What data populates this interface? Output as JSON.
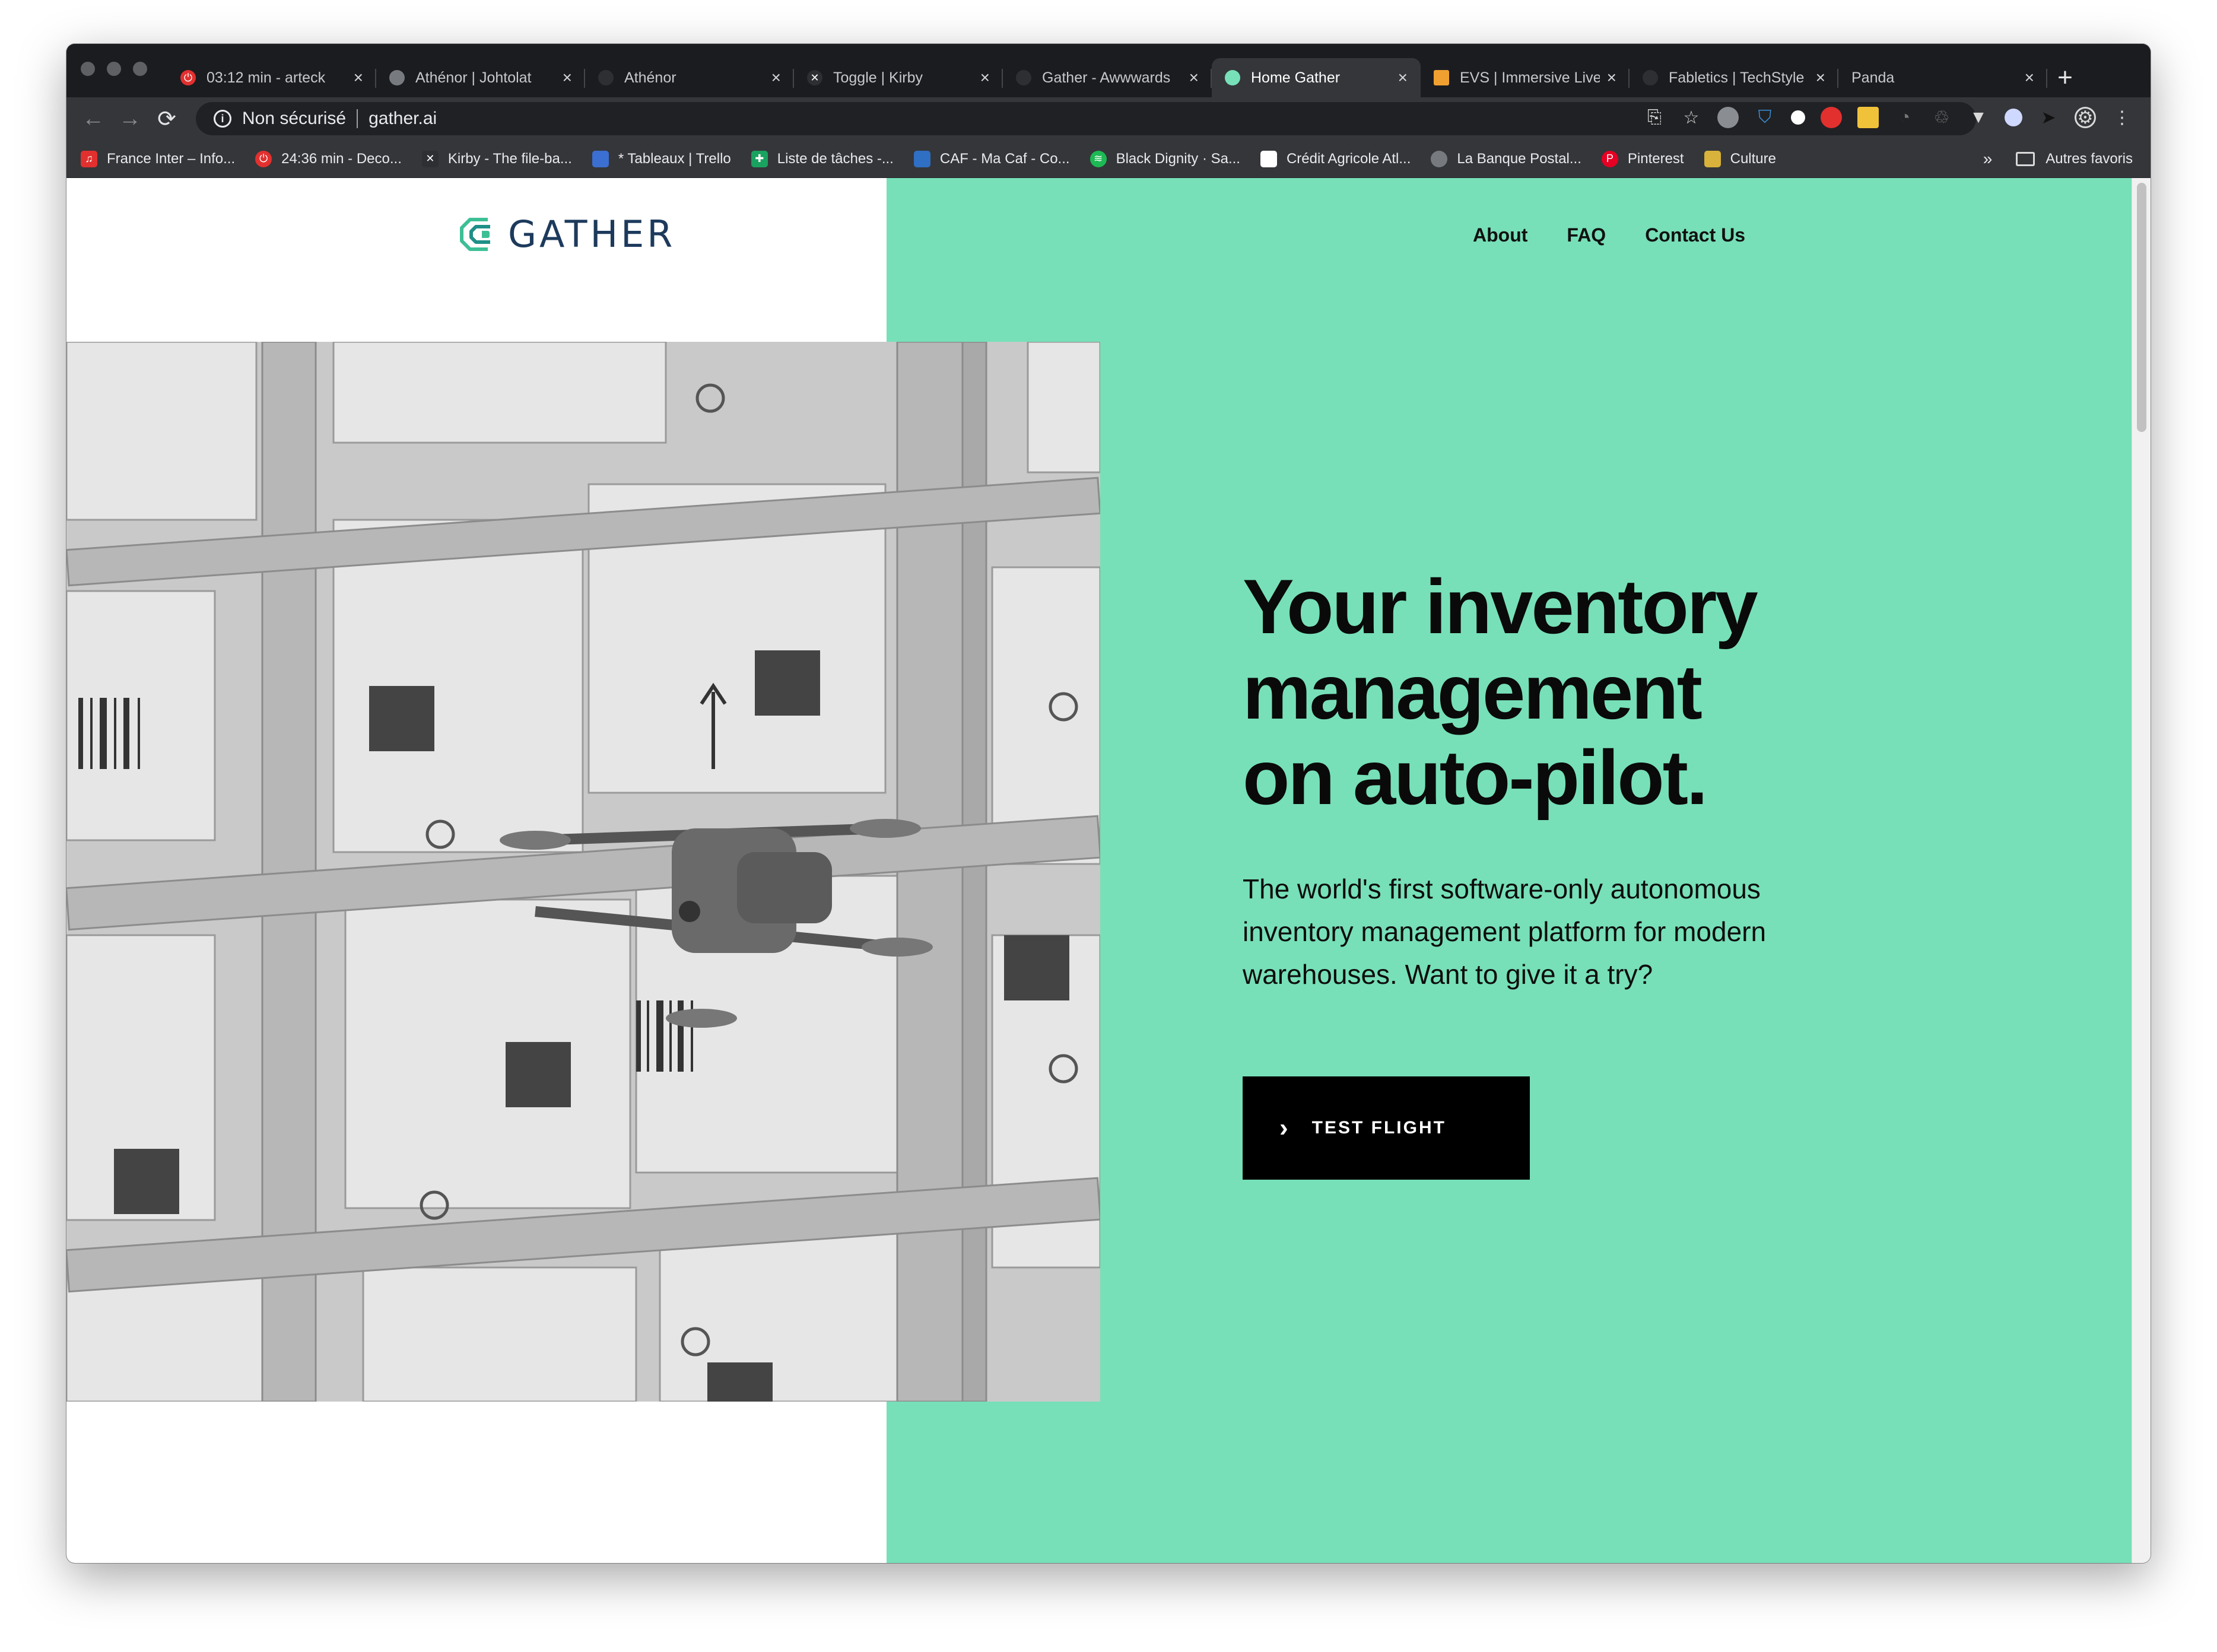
{
  "browser": {
    "tabs": [
      {
        "title": "03:12 min - arteck",
        "favicon": "red-circle-icon",
        "color": "#e2302f"
      },
      {
        "title": "Athénor | Johtolat",
        "favicon": "globe-icon",
        "color": "#777b80"
      },
      {
        "title": "Athénor",
        "favicon": "shield-icon",
        "color": "#2e2f33"
      },
      {
        "title": "Toggle | Kirby",
        "favicon": "kirby-icon",
        "color": "#2e2f33"
      },
      {
        "title": "Gather - Awwwards",
        "favicon": "awwwards-icon",
        "color": "#2e2f33"
      },
      {
        "title": "Home Gather",
        "favicon": "gather-icon",
        "color": "#77e0b8",
        "active": true
      },
      {
        "title": "EVS | Immersive Live",
        "favicon": "evs-icon",
        "color": "#f0a030"
      },
      {
        "title": "Fabletics | TechStyle",
        "favicon": "dot-icon",
        "color": "#2e2f33"
      },
      {
        "title": "Panda",
        "favicon": "blank-icon",
        "color": "#35363a"
      }
    ],
    "address": {
      "security": "Non sécurisé",
      "url": "gather.ai"
    },
    "bookmarks": [
      {
        "label": "France Inter – Info...",
        "color": "#e2302f"
      },
      {
        "label": "24:36 min - Deco...",
        "color": "#e2302f"
      },
      {
        "label": "Kirby - The file-ba...",
        "color": "#2e2f33"
      },
      {
        "label": "* Tableaux | Trello",
        "color": "#3b6fd1"
      },
      {
        "label": "Liste de tâches -...",
        "color": "#1aa260"
      },
      {
        "label": "CAF - Ma Caf - Co...",
        "color": "#2f6fc4"
      },
      {
        "label": "Black Dignity · Sa...",
        "color": "#1db954"
      },
      {
        "label": "Crédit Agricole Atl...",
        "color": "#ffffff"
      },
      {
        "label": "La Banque Postal...",
        "color": "#777b80"
      },
      {
        "label": "Pinterest",
        "color": "#e60023"
      },
      {
        "label": "Culture",
        "color": "#d8b23a"
      }
    ],
    "bookmarks_more": "»",
    "other_bookmarks": "Autres favoris"
  },
  "page": {
    "logo": "GATHER",
    "nav": [
      "About",
      "FAQ",
      "Contact Us"
    ],
    "headline": [
      "Your inventory",
      "management",
      "on auto-pilot."
    ],
    "subtext": "The world's first software-only autonomous inventory management platform for modern warehouses. Want to give it a try?",
    "cta": "TEST FLIGHT",
    "colors": {
      "accent": "#77e0b8",
      "logo": "#1d3a5c",
      "button": "#000000"
    }
  }
}
